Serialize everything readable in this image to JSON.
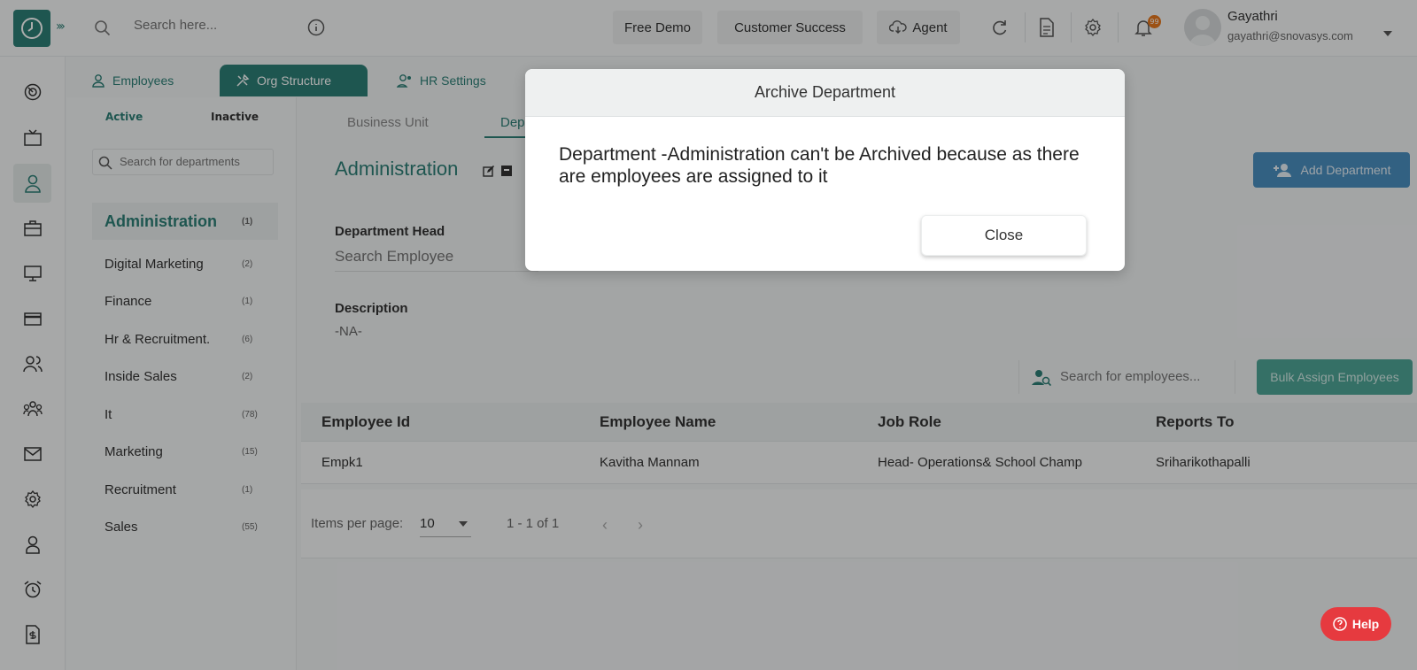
{
  "colors": {
    "brand": "#2d7f76",
    "accent_blue": "#4a8fc0",
    "help_red": "#e63a3f",
    "badge_orange": "#e6781e"
  },
  "header": {
    "search_placeholder": "Search here...",
    "buttons": {
      "free_demo": "Free Demo",
      "customer_success": "Customer Success",
      "agent": "Agent"
    },
    "notification_count": "99",
    "user": {
      "name": "Gayathri",
      "email": "gayathri@snovasys.com"
    },
    "icons": [
      "clock-logo-icon",
      "expand-icon",
      "search-icon",
      "info-icon",
      "cloud-download-icon",
      "refresh-icon",
      "document-icon",
      "settings-icon",
      "bell-icon",
      "avatar",
      "chevron-down-icon"
    ]
  },
  "sidebar": {
    "icons": [
      "dashboard-icon",
      "tv-icon",
      "user-icon",
      "briefcase-icon",
      "monitor-icon",
      "card-icon",
      "people-icon",
      "team-icon",
      "mail-icon",
      "gear-icon",
      "person-badge-icon",
      "alarm-icon",
      "invoice-icon"
    ],
    "active_index": 2
  },
  "module_tabs": [
    {
      "label": "Employees"
    },
    {
      "label": "Org Structure"
    },
    {
      "label": "HR Settings"
    }
  ],
  "departments": {
    "status_tabs": {
      "active": "Active",
      "inactive": "Inactive"
    },
    "search_placeholder": "Search for departments",
    "items": [
      {
        "name": "Administration",
        "count": "(1)"
      },
      {
        "name": "Digital Marketing",
        "count": "(2)"
      },
      {
        "name": "Finance",
        "count": "(1)"
      },
      {
        "name": "Hr & Recruitment.",
        "count": "(6)"
      },
      {
        "name": "Inside Sales",
        "count": "(2)"
      },
      {
        "name": "It",
        "count": "(78)"
      },
      {
        "name": "Marketing",
        "count": "(15)"
      },
      {
        "name": "Recruitment",
        "count": "(1)"
      },
      {
        "name": "Sales",
        "count": "(55)"
      }
    ]
  },
  "main": {
    "unit_tabs": {
      "business_unit": "Business Unit",
      "department": "Dep"
    },
    "title": "Administration",
    "add_department": "Add Department",
    "department_head_label": "Department Head",
    "search_employee_placeholder": "Search Employee",
    "description_label": "Description",
    "description_value": "-NA-",
    "employee_search_placeholder": "Search for employees...",
    "bulk_assign": "Bulk Assign Employees",
    "table": {
      "columns": [
        "Employee Id",
        "Employee Name",
        "Job Role",
        "Reports To"
      ],
      "rows": [
        [
          "Empk1",
          "Kavitha Mannam",
          "Head- Operations& School Champ",
          "Sriharikothapalli"
        ]
      ]
    },
    "pager": {
      "items_per_page_label": "Items per page:",
      "items_per_page": "10",
      "range": "1 - 1 of 1"
    }
  },
  "modal": {
    "title": "Archive Department",
    "message": "Department -Administration can't be Archived because as there are employees are assigned to it",
    "close": "Close"
  },
  "help": "Help"
}
